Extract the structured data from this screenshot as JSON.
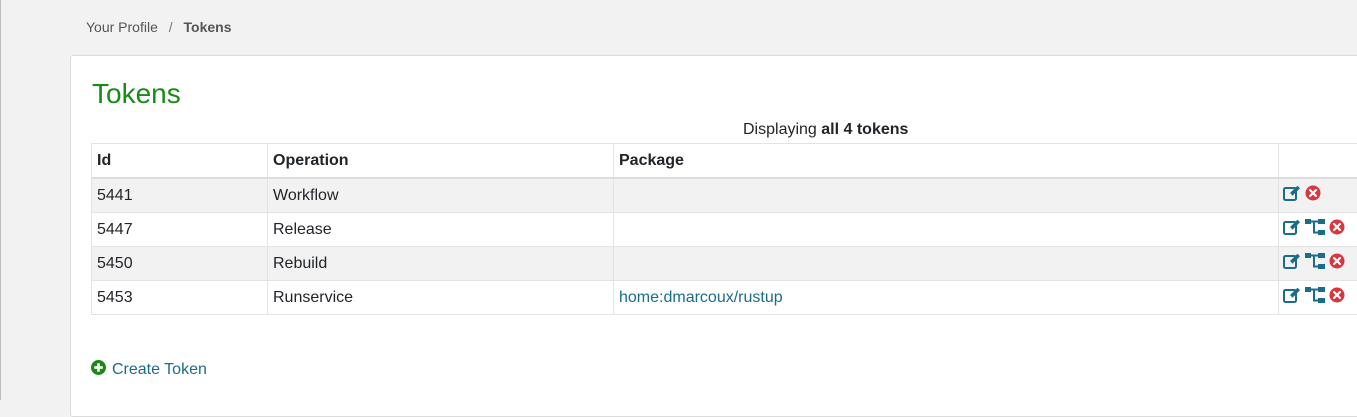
{
  "breadcrumb": {
    "items": [
      "Your Profile",
      "Tokens"
    ],
    "separator": "/"
  },
  "page_title": "Tokens",
  "summary": {
    "prefix": "Displaying",
    "emphasis": "all 4 tokens"
  },
  "table": {
    "columns": [
      "Id",
      "Operation",
      "Package",
      ""
    ],
    "rows": [
      {
        "id": "5441",
        "operation": "Workflow",
        "package": "",
        "actions": [
          "edit-icon",
          "delete-icon"
        ]
      },
      {
        "id": "5447",
        "operation": "Release",
        "package": "",
        "actions": [
          "edit-icon",
          "sitemap-icon",
          "delete-icon"
        ]
      },
      {
        "id": "5450",
        "operation": "Rebuild",
        "package": "",
        "actions": [
          "edit-icon",
          "sitemap-icon",
          "delete-icon"
        ]
      },
      {
        "id": "5453",
        "operation": "Runservice",
        "package": "home:dmarcoux/rustup",
        "actions": [
          "edit-icon",
          "sitemap-icon",
          "delete-icon"
        ]
      }
    ]
  },
  "create_token": {
    "label": "Create Token",
    "icon": "plus-circle-icon"
  },
  "colors": {
    "title_green": "#1a8a17",
    "link_blue": "#1a6c8a",
    "delete_red": "#d9363e",
    "plus_green": "#1a8a17"
  }
}
